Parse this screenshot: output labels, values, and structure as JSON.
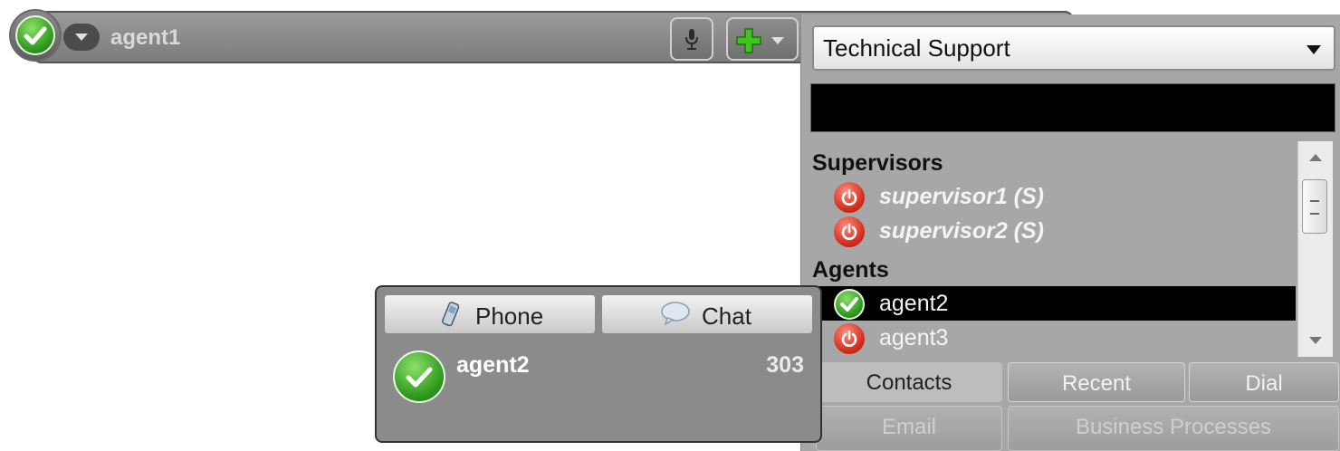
{
  "toolbar": {
    "agent_name": "agent1",
    "status": "ready",
    "icons": {
      "status": "check-icon",
      "mic": "microphone-icon",
      "add": "plus-icon"
    }
  },
  "contacts": {
    "department": "Technical Support",
    "search_value": "",
    "groups": [
      {
        "header": "Supervisors",
        "items": [
          {
            "name": "supervisor1 (S)",
            "status": "logged-out"
          },
          {
            "name": "supervisor2 (S)",
            "status": "logged-out"
          }
        ]
      },
      {
        "header": "Agents",
        "items": [
          {
            "name": "agent2",
            "status": "ready",
            "selected": true
          },
          {
            "name": "agent3",
            "status": "logged-out"
          }
        ]
      }
    ],
    "tabs": {
      "contacts": "Contacts",
      "recent": "Recent",
      "dial": "Dial",
      "email": "Email",
      "business": "Business Processes"
    }
  },
  "popup": {
    "phone_label": "Phone",
    "chat_label": "Chat",
    "agent_name": "agent2",
    "extension": "303"
  },
  "colors": {
    "ready_green": "#2f9a1e",
    "logged_out_red": "#d22c1c",
    "callout_fill": "#cdeff3"
  }
}
